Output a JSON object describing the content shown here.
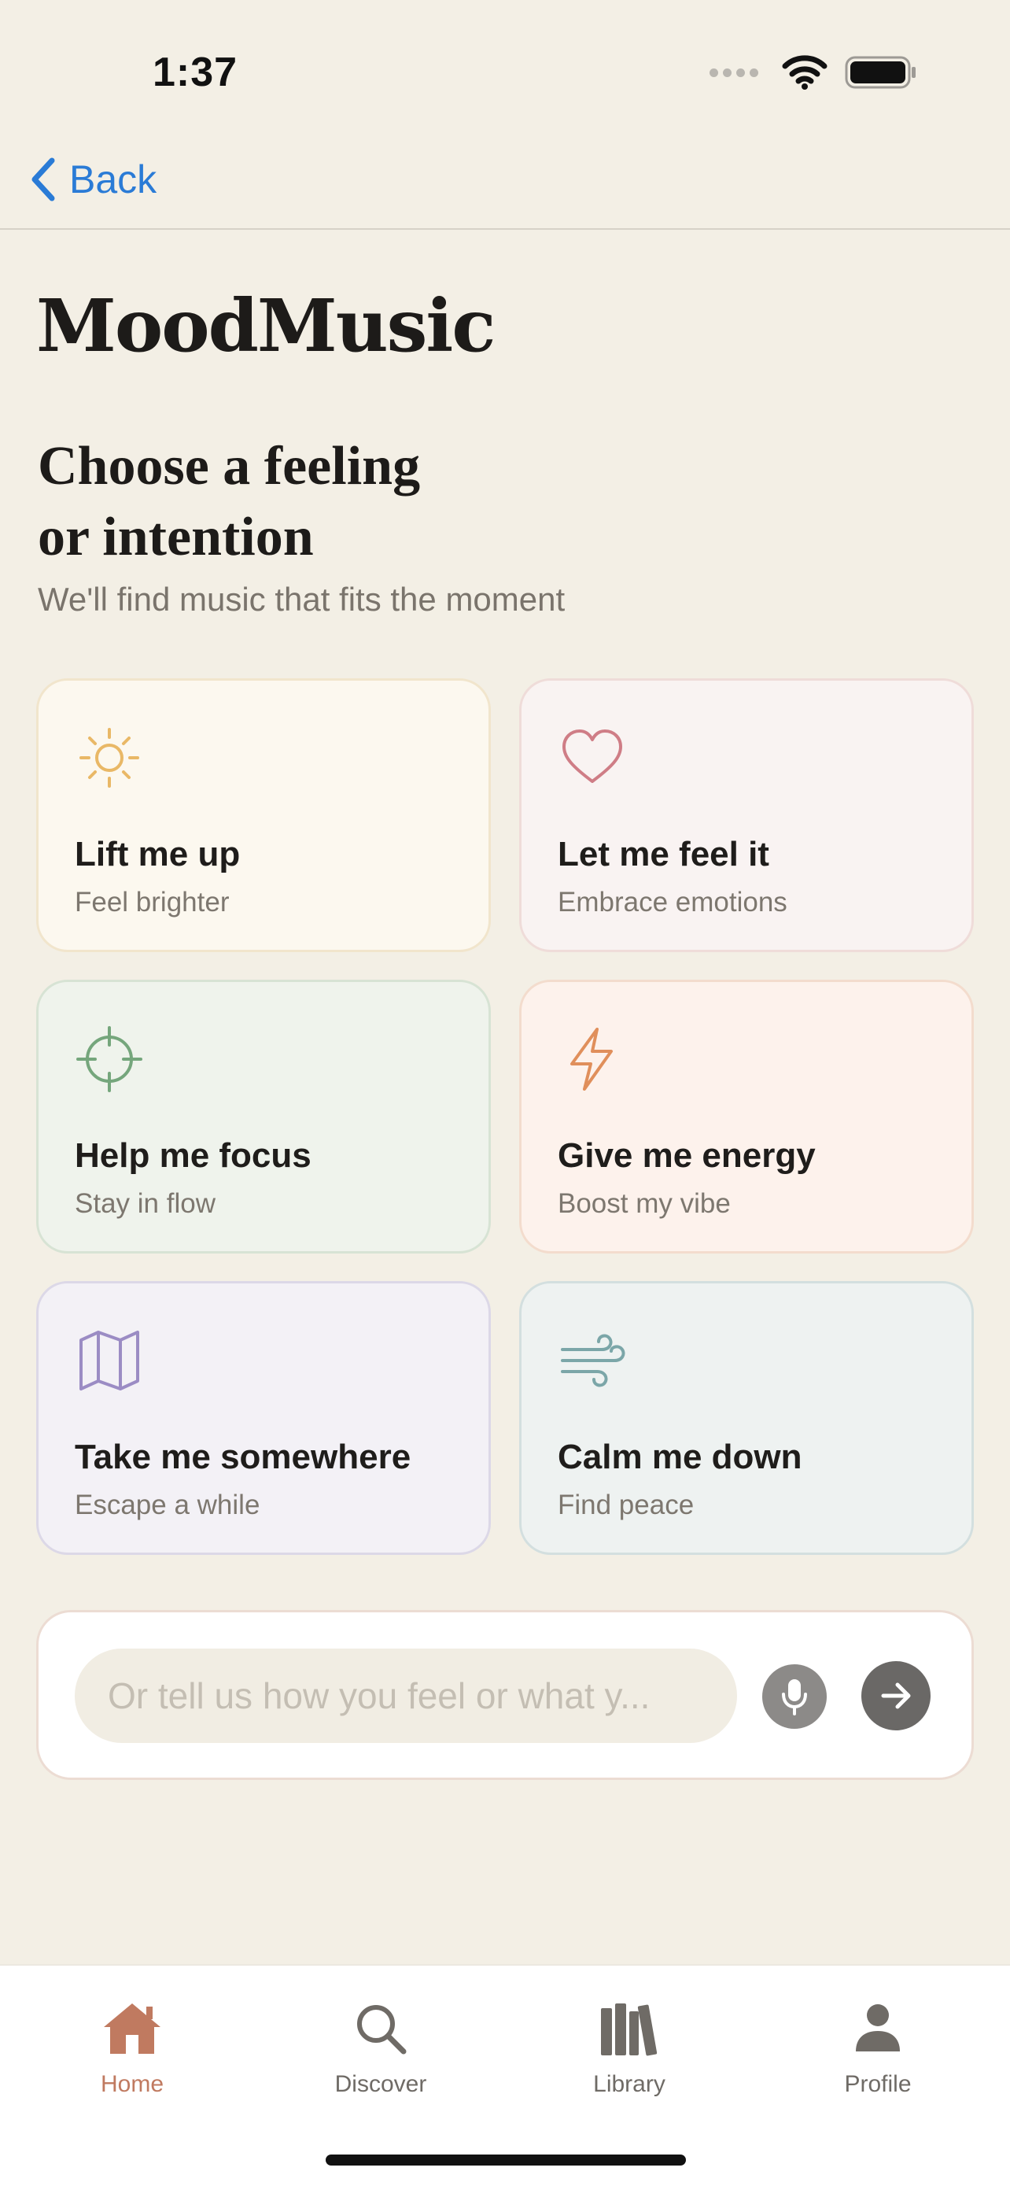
{
  "status_bar": {
    "time": "1:37"
  },
  "nav": {
    "back_label": "Back"
  },
  "app": {
    "title": "MoodMusic"
  },
  "prompt": {
    "heading_line1": "Choose a feeling",
    "heading_line2": "or intention",
    "subtitle": "We'll find music that fits the moment"
  },
  "moods": [
    {
      "title": "Lift me up",
      "subtitle": "Feel brighter",
      "icon": "sun-icon",
      "bg": "#fcf8ef",
      "border": "#f1e5cc",
      "icon_color": "#e9b866"
    },
    {
      "title": "Let me feel it",
      "subtitle": "Embrace emotions",
      "icon": "heart-icon",
      "bg": "#f9f3f2",
      "border": "#efdcd9",
      "icon_color": "#cf7d86"
    },
    {
      "title": "Help me focus",
      "subtitle": "Stay in flow",
      "icon": "crosshair-icon",
      "bg": "#eff3ec",
      "border": "#d7e3d4",
      "icon_color": "#75a67c"
    },
    {
      "title": "Give me energy",
      "subtitle": "Boost my vibe",
      "icon": "lightning-icon",
      "bg": "#fdf2ec",
      "border": "#f3dccd",
      "icon_color": "#e08f5b"
    },
    {
      "title": "Take me somewhere",
      "subtitle": "Escape a while",
      "icon": "map-icon",
      "bg": "#f3f1f6",
      "border": "#dcd8e7",
      "icon_color": "#9b8cc4"
    },
    {
      "title": "Calm me down",
      "subtitle": "Find peace",
      "icon": "wind-icon",
      "bg": "#eef2f1",
      "border": "#d3dfdf",
      "icon_color": "#7ba6a8"
    }
  ],
  "input": {
    "placeholder": "Or tell us how you feel or what y..."
  },
  "tabs": [
    {
      "label": "Home",
      "icon": "home-icon",
      "active": true
    },
    {
      "label": "Discover",
      "icon": "search-icon",
      "active": false
    },
    {
      "label": "Library",
      "icon": "library-icon",
      "active": false
    },
    {
      "label": "Profile",
      "icon": "person-icon",
      "active": false
    }
  ],
  "colors": {
    "background": "#f3efe5",
    "accent_link": "#2a7bd6",
    "active_tab": "#c07a60"
  }
}
